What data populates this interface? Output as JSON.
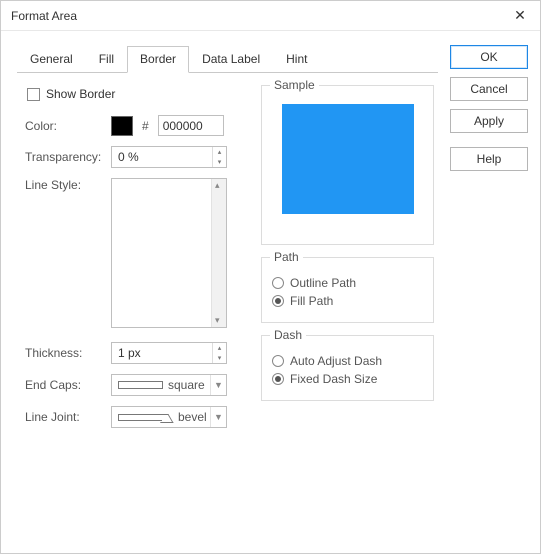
{
  "window": {
    "title": "Format Area"
  },
  "buttons": {
    "ok": "OK",
    "cancel": "Cancel",
    "apply": "Apply",
    "help": "Help"
  },
  "tabs": {
    "general": "General",
    "fill": "Fill",
    "border": "Border",
    "data_label": "Data Label",
    "hint": "Hint",
    "active": "border"
  },
  "border": {
    "show_border_label": "Show Border",
    "show_border_checked": false,
    "color_label": "Color:",
    "color_hex": "000000",
    "color_swatch": "#000000",
    "transparency_label": "Transparency:",
    "transparency_value": "0 %",
    "line_style_label": "Line Style:",
    "thickness_label": "Thickness:",
    "thickness_value": "1 px",
    "end_caps_label": "End Caps:",
    "end_caps_value": "square",
    "line_joint_label": "Line Joint:",
    "line_joint_value": "bevel"
  },
  "sample": {
    "legend": "Sample",
    "color": "#2196f3"
  },
  "path": {
    "legend": "Path",
    "outline": "Outline Path",
    "fill": "Fill Path",
    "selected": "fill"
  },
  "dash": {
    "legend": "Dash",
    "auto": "Auto Adjust Dash",
    "fixed": "Fixed Dash Size",
    "selected": "fixed"
  }
}
